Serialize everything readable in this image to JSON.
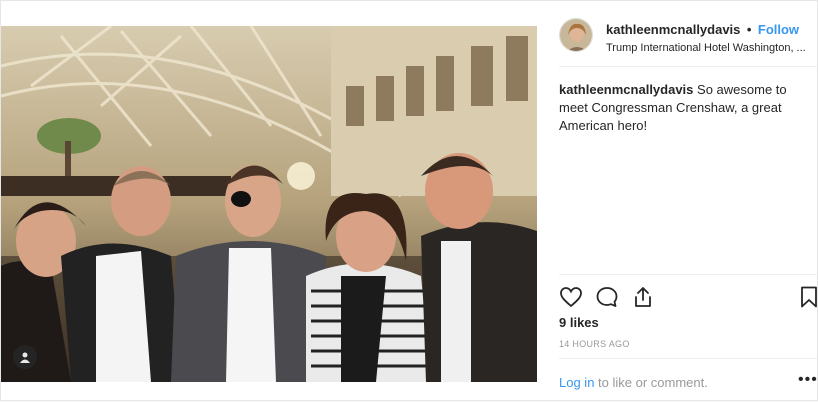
{
  "post": {
    "username": "kathleenmcnallydavis",
    "separator": "•",
    "follow_label": "Follow",
    "location": "Trump International Hotel Washington, ...",
    "caption_user": "kathleenmcnallydavis",
    "caption_text": "So awesome to meet Congressman Crenshaw, a great American hero!",
    "likes": "9 likes",
    "timestamp": "14 HOURS AGO",
    "login_link": "Log in",
    "login_rest": "to like or comment.",
    "more": "•••"
  },
  "icons": {
    "like": "heart-icon",
    "comment": "comment-icon",
    "share": "share-icon",
    "save": "bookmark-icon",
    "tag": "user-tag-icon"
  },
  "colors": {
    "link": "#3897f0",
    "muted": "#999999",
    "text": "#262626"
  }
}
